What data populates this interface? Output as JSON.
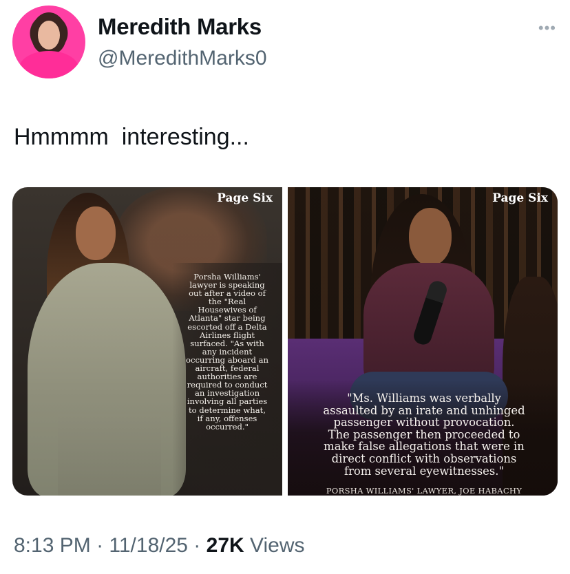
{
  "author": {
    "name": "Meredith Marks",
    "handle": "@MeredithMarks0",
    "more_icon": "more-horizontal-icon"
  },
  "tweet": {
    "text": "Hmmmm  interesting..."
  },
  "media": {
    "left": {
      "brand": "Page Six",
      "caption": "Porsha Williams'\nlawyer is speaking\nout after a video of\nthe \"Real\nHousewives of\nAtlanta\" star being\nescorted off a Delta\nAirlines flight\nsurfaced. \"As with\nany incident\noccurring aboard an\naircraft, federal\nauthorities are\nrequired to conduct\nan investigation\ninvolving all parties\nto determine what,\nif any, offenses\noccurred.\""
    },
    "right": {
      "brand": "Page Six",
      "quote": "\"Ms. Williams was verbally\nassaulted by an irate and unhinged\npassenger without provocation.\nThe passenger then proceeded to\nmake false allegations that were in\ndirect conflict with observations\nfrom several eyewitnesses.\"",
      "attribution": "PORSHA WILLIAMS' LAWYER, JOE HABACHY"
    }
  },
  "meta": {
    "time": "8:13 PM",
    "separator": " · ",
    "date": "11/18/25",
    "views_count": "27K",
    "views_label": " Views"
  }
}
